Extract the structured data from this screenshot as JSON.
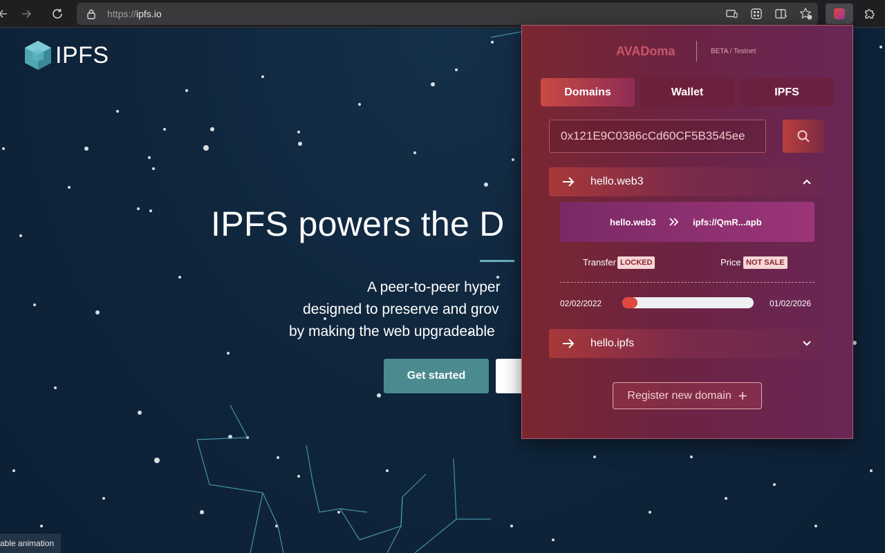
{
  "browser": {
    "url_scheme": "https://",
    "url_host": "ipfs.io"
  },
  "page": {
    "logo_text": "IPFS",
    "hero_title": "IPFS powers the D",
    "subtitle_lines": [
      "A peer-to-peer hyper",
      "designed to preserve and grov",
      "by making the web upgradeable"
    ],
    "get_started_label": "Get started",
    "bottom_label": "able animation"
  },
  "popup": {
    "brand": "AVADoma",
    "beta": "BETA / Testnet",
    "tabs": [
      {
        "label": "Domains",
        "active": true
      },
      {
        "label": "Wallet",
        "active": false
      },
      {
        "label": "IPFS",
        "active": false
      }
    ],
    "search_value": "0x121E9C0386cCd60CF5B3545ee",
    "domains": [
      {
        "name": "hello.web3",
        "expanded": true,
        "mapping_from": "hello.web3",
        "mapping_to": "ipfs://QmR...apb",
        "transfer_label": "Transfer",
        "transfer_status": "LOCKED",
        "price_label": "Price",
        "price_status": "NOT SALE",
        "start_date": "02/02/2022",
        "end_date": "01/02/2026",
        "progress": 0.05
      },
      {
        "name": "hello.ipfs",
        "expanded": false
      }
    ],
    "register_label": "Register new domain",
    "accent": "#e04a3e"
  }
}
